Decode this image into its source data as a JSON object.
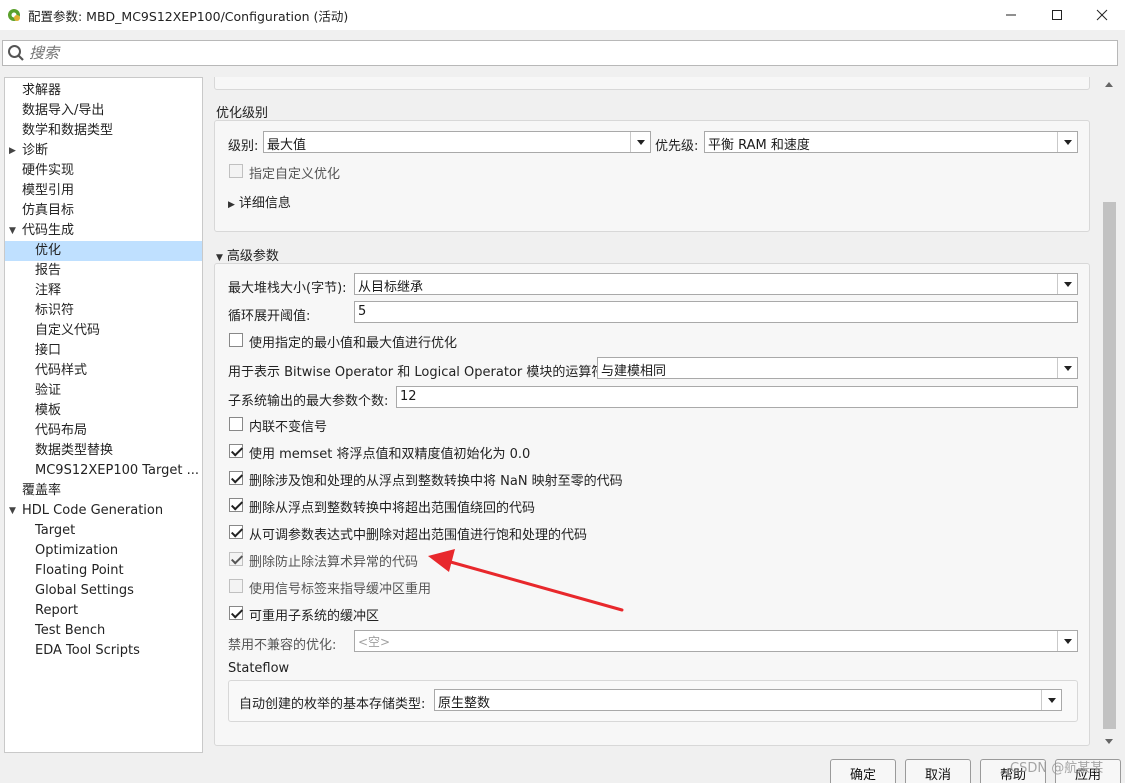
{
  "window": {
    "title": "配置参数: MBD_MC9S12XEP100/Configuration (活动)"
  },
  "search": {
    "placeholder": "搜索"
  },
  "tree": [
    {
      "label": "求解器"
    },
    {
      "label": "数据导入/导出"
    },
    {
      "label": "数学和数据类型"
    },
    {
      "label": "诊断"
    },
    {
      "label": "硬件实现"
    },
    {
      "label": "模型引用"
    },
    {
      "label": "仿真目标"
    },
    {
      "label": "代码生成"
    },
    {
      "label": "优化"
    },
    {
      "label": "报告"
    },
    {
      "label": "注释"
    },
    {
      "label": "标识符"
    },
    {
      "label": "自定义代码"
    },
    {
      "label": "接口"
    },
    {
      "label": "代码样式"
    },
    {
      "label": "验证"
    },
    {
      "label": "模板"
    },
    {
      "label": "代码布局"
    },
    {
      "label": "数据类型替换"
    },
    {
      "label": "MC9S12XEP100 Target ..."
    },
    {
      "label": "覆盖率"
    },
    {
      "label": "HDL Code Generation"
    },
    {
      "label": "Target"
    },
    {
      "label": "Optimization"
    },
    {
      "label": "Floating Point"
    },
    {
      "label": "Global Settings"
    },
    {
      "label": "Report"
    },
    {
      "label": "Test Bench"
    },
    {
      "label": "EDA Tool Scripts"
    }
  ],
  "opt_level": {
    "title": "优化级别",
    "level_label": "级别:",
    "level_value": "最大值",
    "priority_label": "优先级:",
    "priority_value": "平衡 RAM 和速度",
    "custom_label": "指定自定义优化",
    "details_label": "详细信息"
  },
  "advanced": {
    "title": "高级参数",
    "stack_label": "最大堆栈大小(字节):",
    "stack_value": "从目标继承",
    "loop_label": "循环展开阈值:",
    "loop_value": "5",
    "minmax_label": "使用指定的最小值和最大值进行优化",
    "bitwise_label": "用于表示 Bitwise Operator 和 Logical Operator 模块的运算符:",
    "bitwise_value": "与建模相同",
    "maxargs_label": "子系统输出的最大参数个数:",
    "maxargs_value": "12",
    "inline_label": "内联不变信号",
    "memset_label": "使用 memset 将浮点值和双精度值初始化为 0.0",
    "nan_label": "删除涉及饱和处理的从浮点到整数转换中将 NaN 映射至零的代码",
    "wrap_label": "删除从浮点到整数转换中将超出范围值绕回的代码",
    "sat_label": "从可调参数表达式中删除对超出范围值进行饱和处理的代码",
    "div_label": "删除防止除法算术异常的代码",
    "siglabel_label": "使用信号标签来指导缓冲区重用",
    "reuse_label": "可重用子系统的缓冲区",
    "incompat_label": "禁用不兼容的优化:",
    "incompat_value": "<空>",
    "stateflow_title": "Stateflow",
    "enum_label": "自动创建的枚举的基本存储类型:",
    "enum_value": "原生整数"
  },
  "buttons": {
    "ok": "确定",
    "cancel": "取消",
    "help": "帮助",
    "apply": "应用"
  },
  "watermark": "CSDN @航某某",
  "colors": {
    "selection": "#bfe0ff",
    "arrow": "#e8282c"
  }
}
